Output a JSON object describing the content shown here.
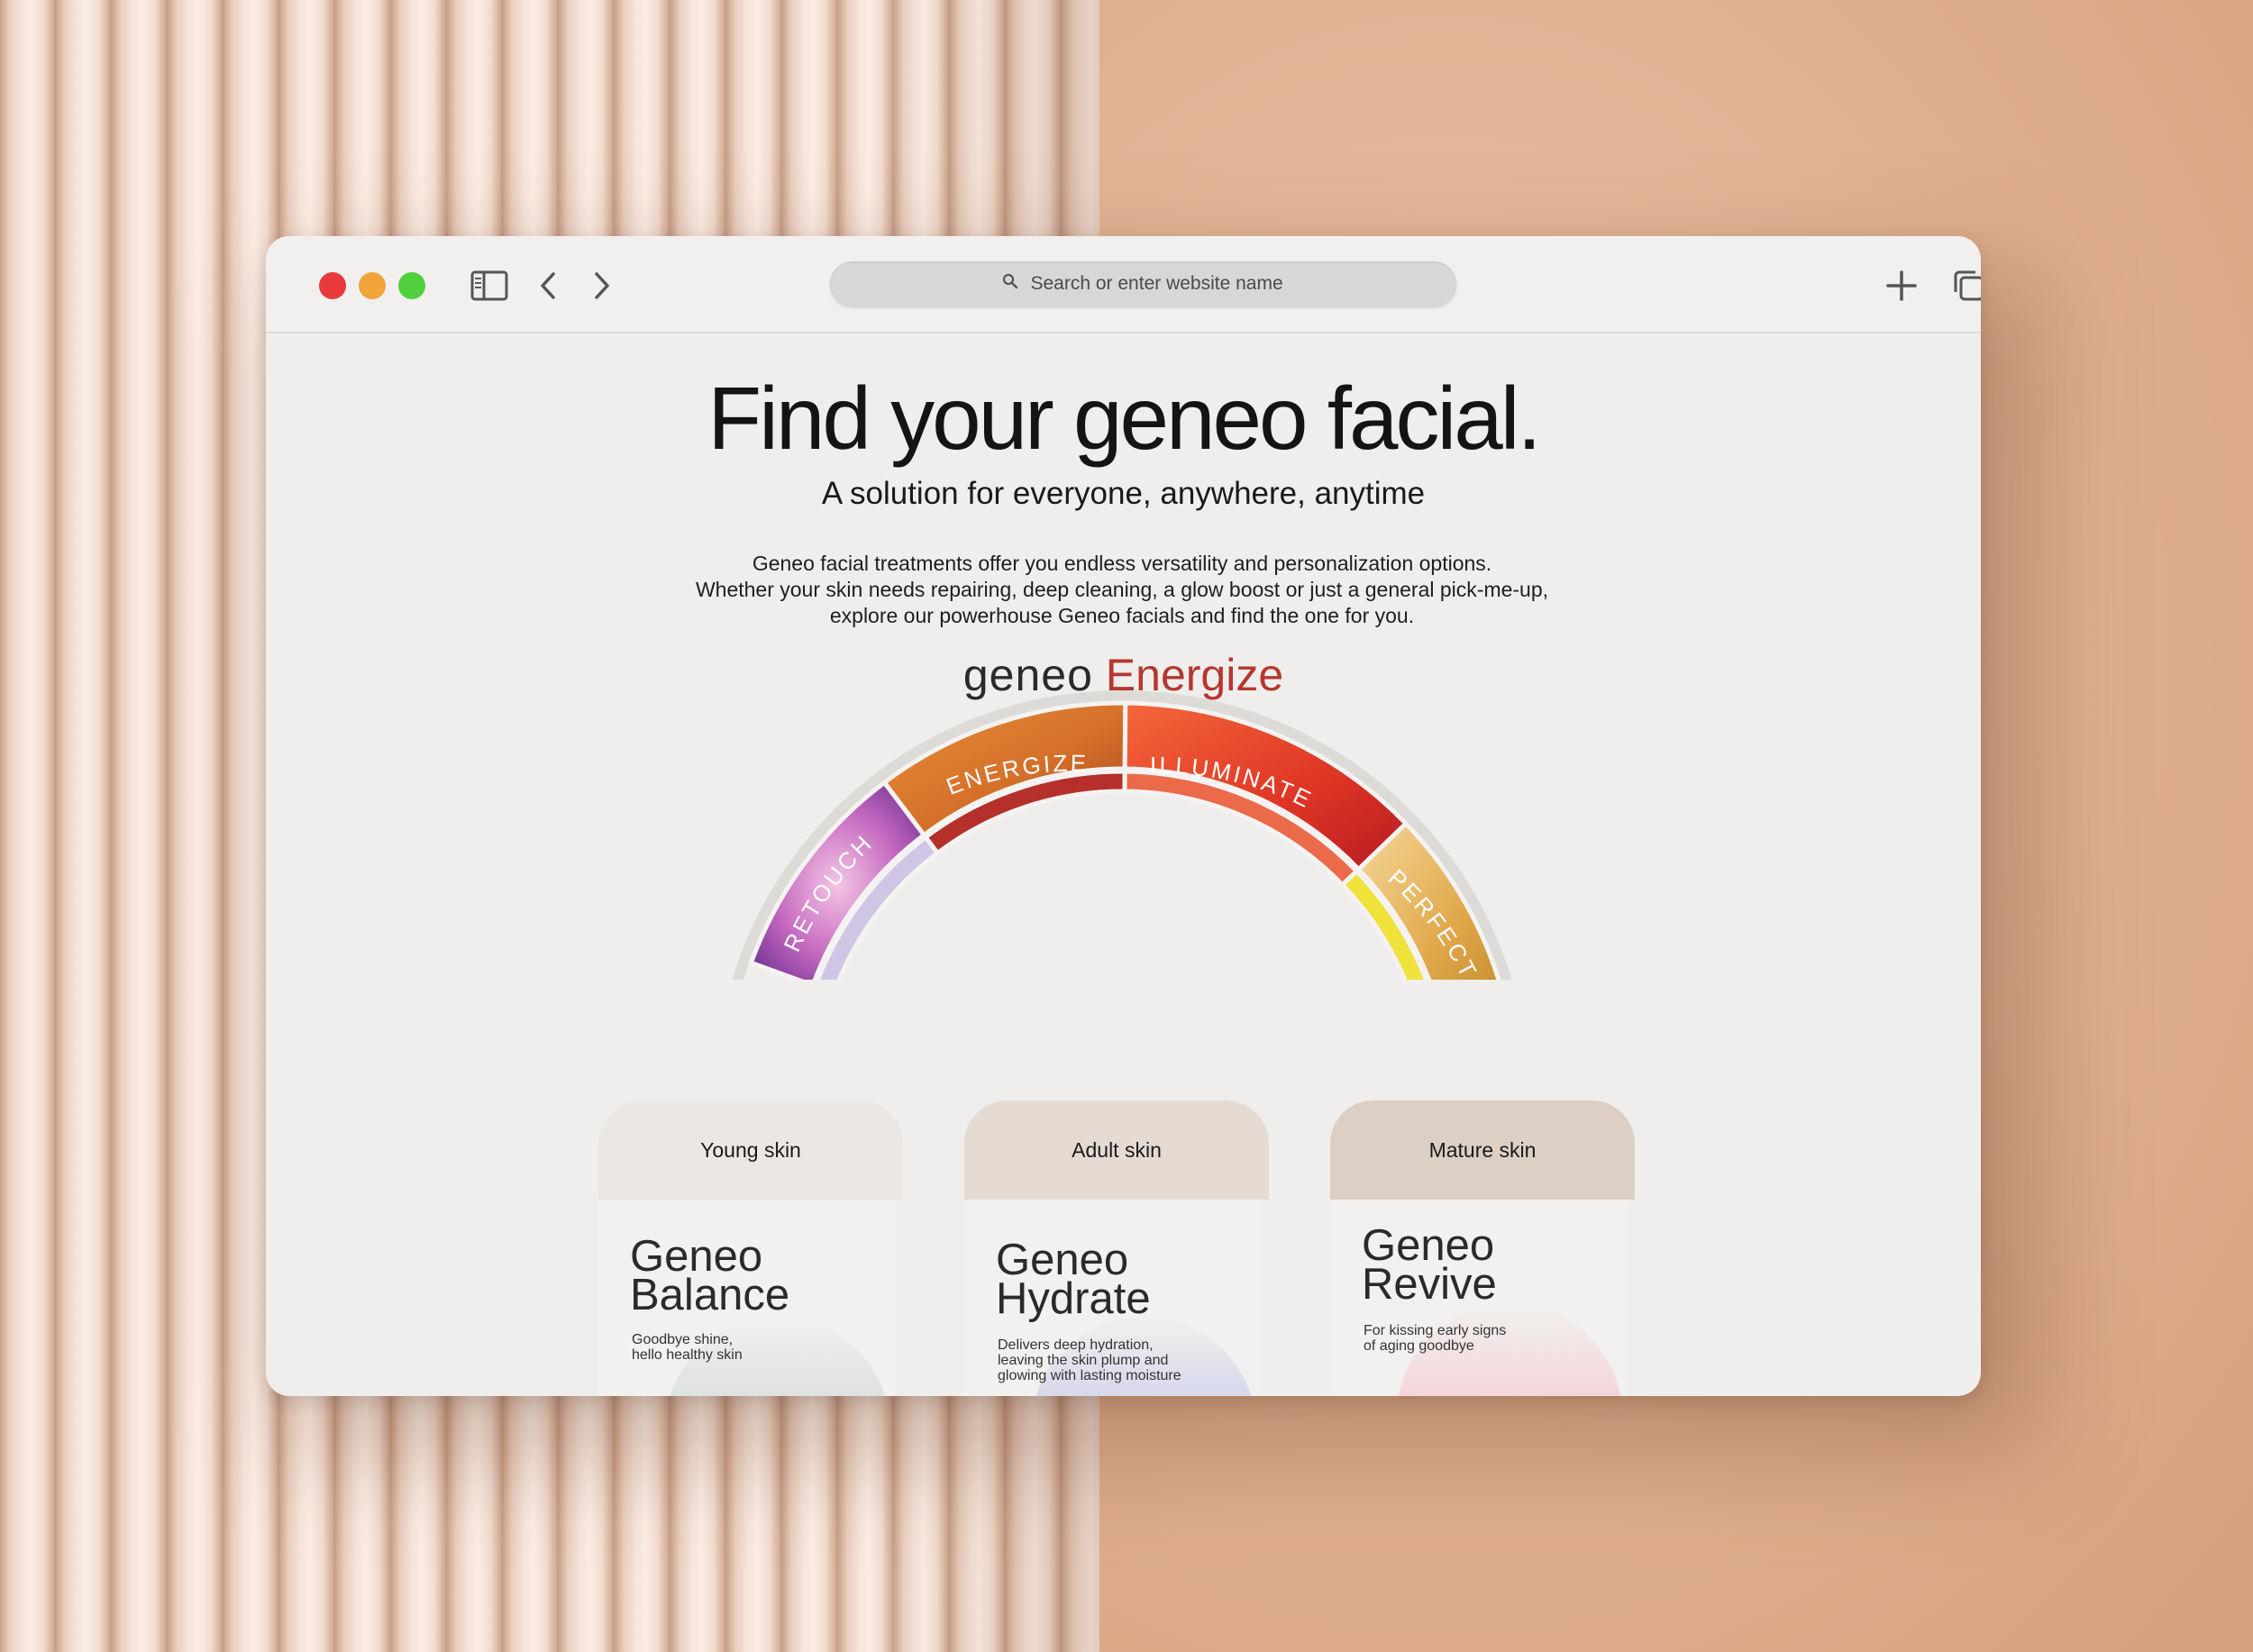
{
  "browser": {
    "search_placeholder": "Search or enter website name",
    "icons": [
      "sidebar-icon",
      "back-icon",
      "forward-icon",
      "search-icon",
      "new-tab-icon",
      "tabs-overview-icon"
    ]
  },
  "page": {
    "title": "Find your geneo facial.",
    "subtitle": "A solution for everyone, anywhere, anytime",
    "intro_lines": [
      "Geneo facial treatments offer you endless versatility and personalization options.",
      "Whether your skin needs repairing, deep cleaning, a glow boost or just a general pick-me-up,",
      "explore our powerhouse Geneo facials and find the one for you."
    ],
    "brand_logo": "geneo",
    "brand_product": "Energize",
    "accent_color": "#b5382e"
  },
  "wheel": {
    "segments": [
      {
        "label": "RETOUCH",
        "color": "#b055b4"
      },
      {
        "label": "ENERGIZE",
        "color": "#d9762f"
      },
      {
        "label": "ILLUMINATE",
        "color": "#e03a26"
      },
      {
        "label": "PERFECT",
        "color": "#e8b030"
      }
    ]
  },
  "cards": [
    {
      "tab": "Young skin",
      "title_line1": "Geneo",
      "title_line2": "Balance",
      "desc_lines": [
        "Goodbye shine,",
        "hello healthy skin"
      ],
      "tab_color": "#ece7e3",
      "blob_color": "#a9c0c0"
    },
    {
      "tab": "Adult skin",
      "title_line1": "Geneo",
      "title_line2": "Hydrate",
      "desc_lines": [
        "Delivers deep hydration,",
        "leaving the skin plump and",
        "glowing with lasting moisture"
      ],
      "tab_color": "#e5dbd3",
      "blob_color": "#a4abdd"
    },
    {
      "tab": "Mature skin",
      "title_line1": "Geneo",
      "title_line2": "Revive",
      "desc_lines": [
        "For kissing early signs",
        "of aging goodbye"
      ],
      "tab_color": "#ddcfc3",
      "blob_color": "#f0b9c3"
    }
  ]
}
